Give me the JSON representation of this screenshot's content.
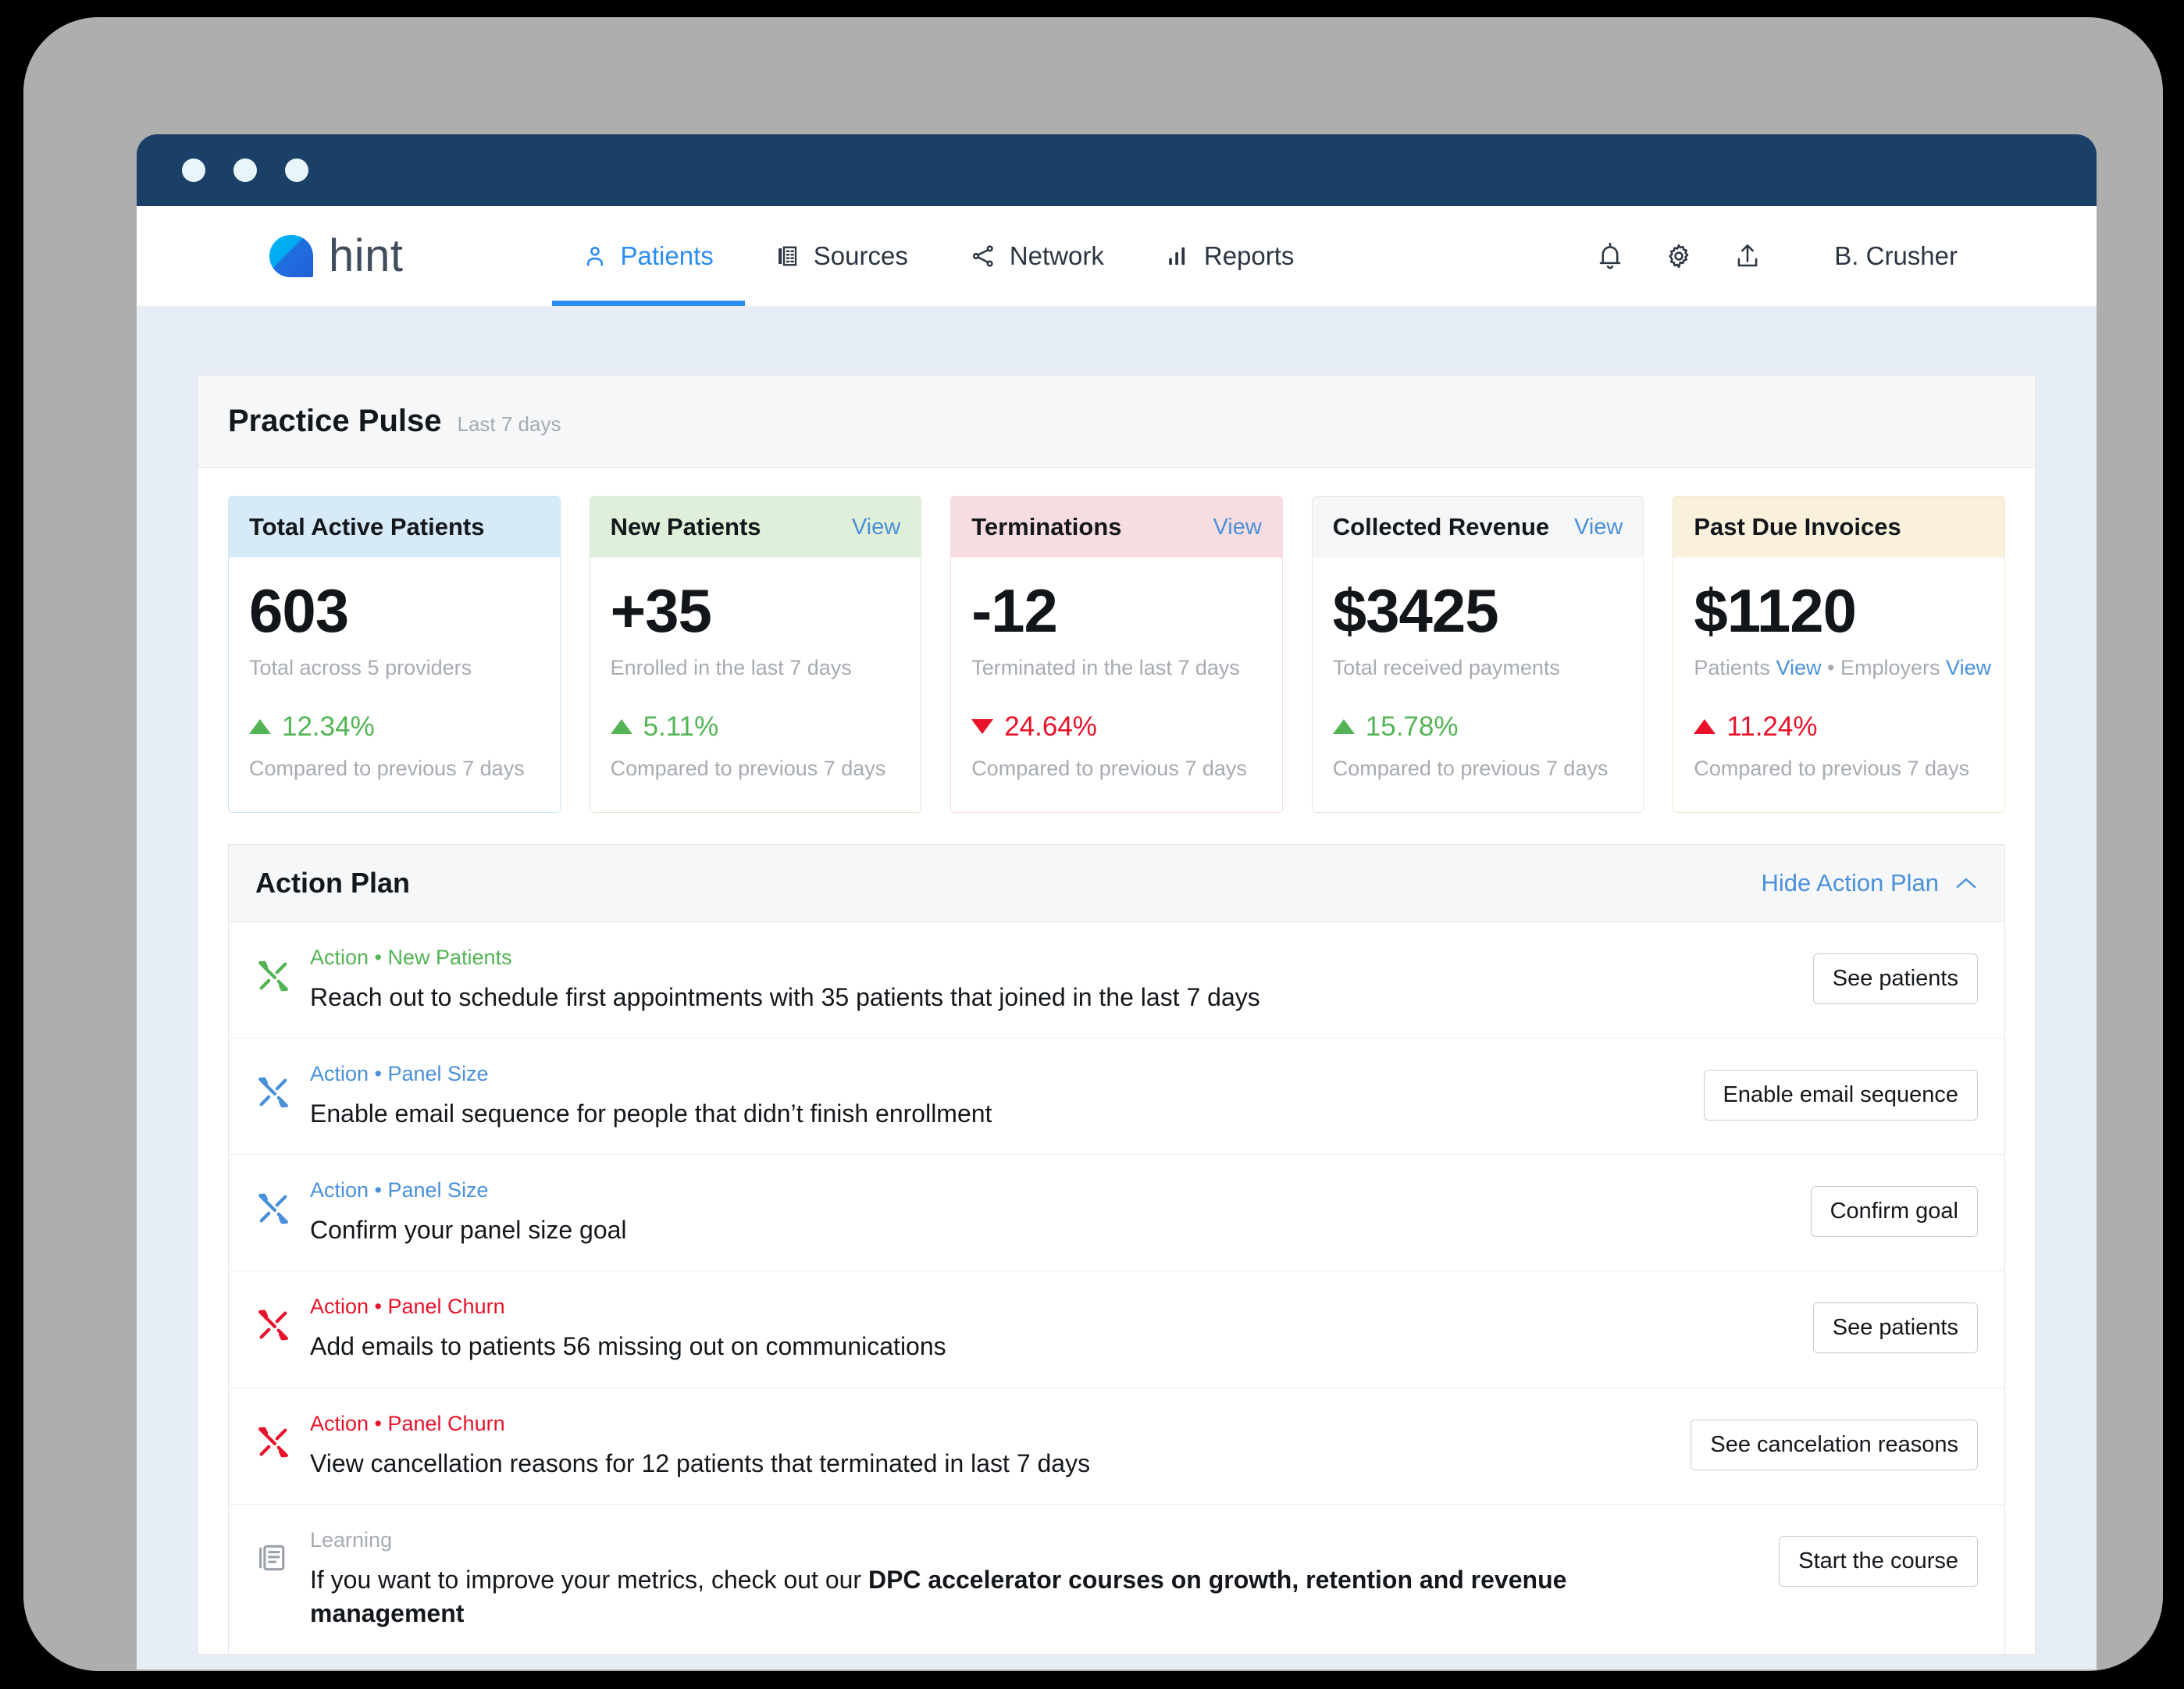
{
  "window": {
    "dots": [
      "dot-1",
      "dot-2",
      "dot-3"
    ]
  },
  "header": {
    "logo_text": "hint",
    "nav": [
      {
        "label": "Patients",
        "icon": "person-icon",
        "active": true
      },
      {
        "label": "Sources",
        "icon": "building-icon",
        "active": false
      },
      {
        "label": "Network",
        "icon": "share-network-icon",
        "active": false
      },
      {
        "label": "Reports",
        "icon": "bar-chart-icon",
        "active": false
      }
    ],
    "icons": [
      "bell-icon",
      "gear-icon",
      "upload-icon"
    ],
    "user_name": "B. Crusher"
  },
  "pulse": {
    "title": "Practice Pulse",
    "subtitle": "Last 7 days",
    "cards": [
      {
        "title": "Total Active Patients",
        "view_label": "",
        "value": "603",
        "desc": "Total across 5 providers",
        "delta": "12.34%",
        "direction": "up",
        "tone": "up-good",
        "compare": "Compared to previous 7 days",
        "color": "c-blue",
        "accent": "#d6eaf8"
      },
      {
        "title": "New Patients",
        "view_label": "View",
        "value": "+35",
        "desc": "Enrolled in the last 7 days",
        "delta": "5.11%",
        "direction": "up",
        "tone": "up-good",
        "compare": "Compared to previous 7 days",
        "color": "c-green",
        "accent": "#e0efd9"
      },
      {
        "title": "Terminations",
        "view_label": "View",
        "value": "-12",
        "desc": "Terminated in the last 7 days",
        "delta": "24.64%",
        "direction": "down",
        "tone": "down-bad",
        "compare": "Compared to previous 7 days",
        "color": "c-pink",
        "accent": "#f7dde1"
      },
      {
        "title": "Collected Revenue",
        "view_label": "View",
        "value": "$3425",
        "desc": "Total received payments",
        "delta": "15.78%",
        "direction": "up",
        "tone": "up-good",
        "compare": "Compared to previous 7 days",
        "color": "c-gray",
        "accent": "#f5f6f7"
      },
      {
        "title": "Past Due Invoices",
        "view_label": "",
        "value": "$1120",
        "desc_parts": {
          "patients_label": "Patients",
          "patients_view": "View",
          "separator": "•",
          "employers_label": "Employers",
          "employers_view": "View"
        },
        "delta": "11.24%",
        "direction": "up",
        "tone": "up-bad",
        "compare": "Compared to previous 7 days",
        "color": "c-cream",
        "accent": "#faf1dc"
      }
    ]
  },
  "action_plan": {
    "title": "Action Plan",
    "toggle_label": "Hide Action Plan",
    "toggle_icon": "chevron-up-icon",
    "rows": [
      {
        "label": "Action • New Patients",
        "label_tone": "green",
        "icon": "tools-icon",
        "text": "Reach out to schedule first appointments with 35 patients that joined in the last 7 days",
        "button": "See patients"
      },
      {
        "label": "Action • Panel Size",
        "label_tone": "blue",
        "icon": "tools-icon",
        "text": "Enable email sequence for people that didn’t finish enrollment",
        "button": "Enable email sequence"
      },
      {
        "label": "Action • Panel Size",
        "label_tone": "blue",
        "icon": "tools-icon",
        "text": "Confirm your panel size goal",
        "button": "Confirm goal"
      },
      {
        "label": "Action • Panel Churn",
        "label_tone": "red",
        "icon": "tools-icon",
        "text": "Add emails to patients 56 missing out on communications",
        "button": "See patients"
      },
      {
        "label": "Action • Panel Churn",
        "label_tone": "red",
        "icon": "tools-icon",
        "text": "View cancellation reasons for 12 patients that terminated in last 7 days",
        "button": "See cancelation reasons"
      },
      {
        "label": "Learning",
        "label_tone": "gray",
        "icon": "book-icon",
        "text_plain": "If you want to improve your metrics, check out our ",
        "text_bold": "DPC accelerator courses on growth, retention and revenue management",
        "button": "Start the course"
      }
    ]
  },
  "colors": {
    "titlebar": "#1b4068",
    "page_bg": "#e7edf5",
    "accent_blue": "#2a8cf5",
    "link_blue": "#4a90d9",
    "positive_green": "#54b455",
    "negative_red": "#e8132a",
    "muted_gray": "#a6abb2"
  }
}
